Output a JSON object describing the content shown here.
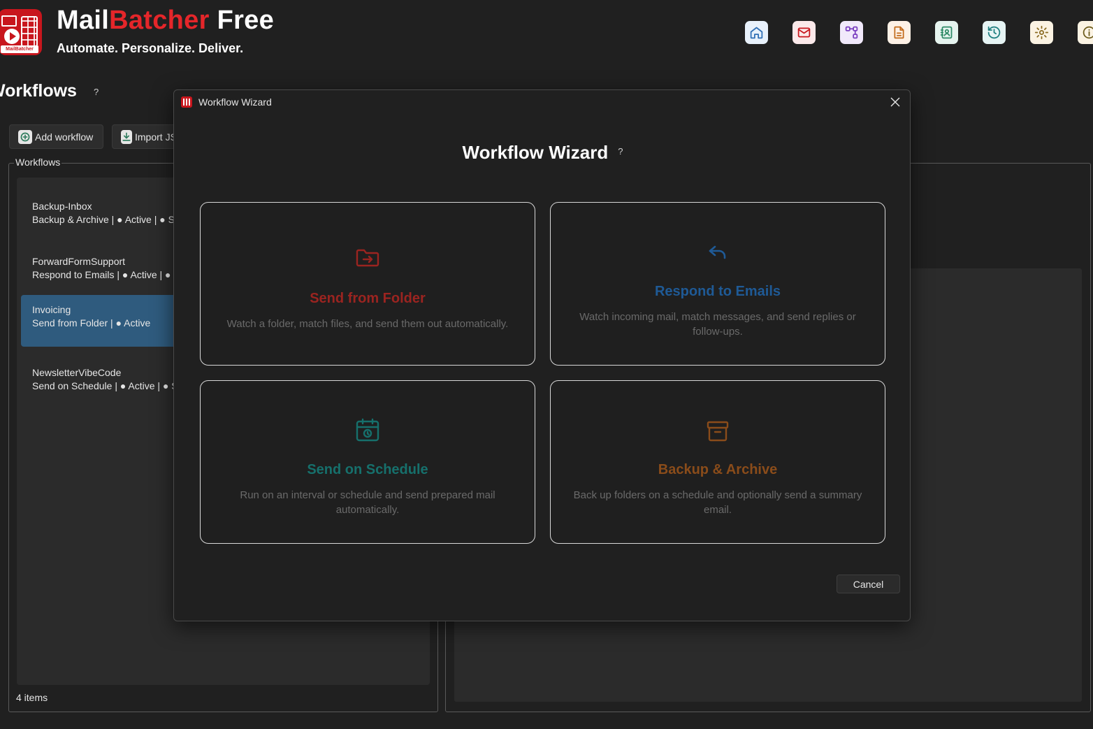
{
  "app": {
    "brand_part1": "Mail",
    "brand_part2": "Batcher",
    "brand_part3": " Free",
    "tagline": "Automate. Personalize. Deliver.",
    "logo_tag": "MailBatcher"
  },
  "toolbar": [
    {
      "name": "home-icon",
      "bg": "#e8f1fb",
      "stroke": "#2f6fb5"
    },
    {
      "name": "mail-icon",
      "bg": "#fbe9ea",
      "stroke": "#c8161d"
    },
    {
      "name": "workflow-icon",
      "bg": "#f1e9fb",
      "stroke": "#7a3fc0"
    },
    {
      "name": "document-icon",
      "bg": "#fdf1e6",
      "stroke": "#c26a1a"
    },
    {
      "name": "contacts-icon",
      "bg": "#e6f4ef",
      "stroke": "#2e8a67"
    },
    {
      "name": "history-icon",
      "bg": "#e6f4f4",
      "stroke": "#1f7f80"
    },
    {
      "name": "settings-icon",
      "bg": "#fbf3e3",
      "stroke": "#8a6a20"
    },
    {
      "name": "info-icon",
      "bg": "#fbf3e3",
      "stroke": "#6b5a1a"
    }
  ],
  "page": {
    "title": "Workflows",
    "help": "?",
    "add_button": "Add workflow",
    "import_button": "Import JSON",
    "group_label": "Workflows",
    "items_count": "4 items"
  },
  "workflows": [
    {
      "name": "Backup-Inbox",
      "detail": "Backup & Archive | ● Active | ● Scheduled"
    },
    {
      "name": "ForwardFormSupport",
      "detail": "Respond to Emails | ● Active | ● Scheduled"
    },
    {
      "name": "Invoicing",
      "detail": "Send from Folder | ● Active",
      "selected": true
    },
    {
      "name": "NewsletterVibeCode",
      "detail": "Send on Schedule | ● Active | ● Scheduled"
    }
  ],
  "wizard": {
    "window_title": "Workflow Wizard",
    "heading": "Workflow Wizard",
    "help": "?",
    "cancel": "Cancel",
    "cards": [
      {
        "title": "Send from Folder",
        "desc": "Watch a folder, match files, and send them out automatically.",
        "color": "#9b2420",
        "icon": "folder-send-icon"
      },
      {
        "title": "Respond to Emails",
        "desc": "Watch incoming mail, match messages, and send replies or follow-ups.",
        "color": "#1f5a96",
        "icon": "reply-icon"
      },
      {
        "title": "Send on Schedule",
        "desc": "Run on an interval or schedule and send prepared mail automatically.",
        "color": "#16706c",
        "icon": "calendar-clock-icon"
      },
      {
        "title": "Backup & Archive",
        "desc": "Back up folders on a schedule and optionally send a summary email.",
        "color": "#8a4c1a",
        "icon": "archive-icon"
      }
    ]
  }
}
